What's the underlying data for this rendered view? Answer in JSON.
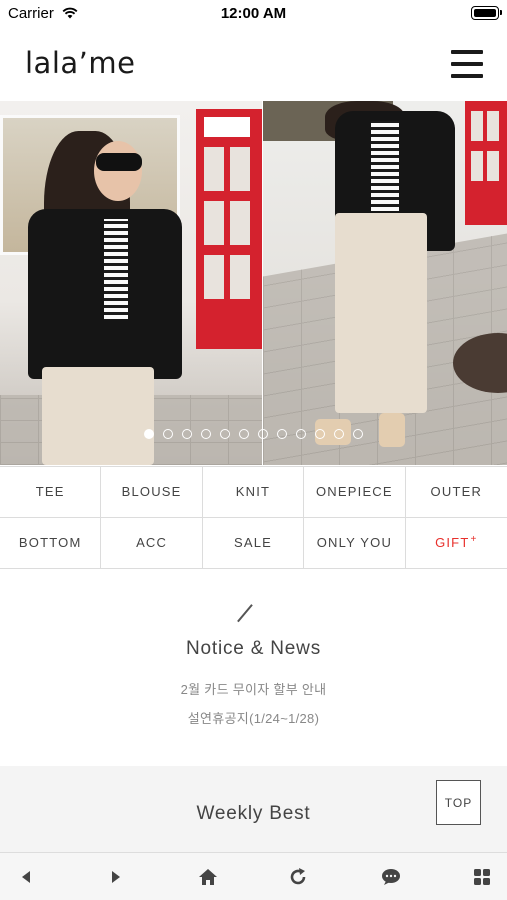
{
  "status": {
    "carrier": "Carrier",
    "time": "12:00 AM"
  },
  "header": {
    "logo": "lala’me"
  },
  "banner": {
    "slide_count": 12,
    "active_slide": 0
  },
  "categories": [
    {
      "label": "TEE"
    },
    {
      "label": "BLOUSE"
    },
    {
      "label": "KNIT"
    },
    {
      "label": "ONEPIECE"
    },
    {
      "label": "OUTER"
    },
    {
      "label": "BOTTOM"
    },
    {
      "label": "ACC"
    },
    {
      "label": "SALE"
    },
    {
      "label": "ONLY YOU"
    },
    {
      "label": "GIFT",
      "badge": "+"
    }
  ],
  "notice": {
    "title": "Notice & News",
    "items": [
      "2월 카드 무이자 할부 안내",
      "설연휴공지(1/24~1/28)"
    ]
  },
  "weekly": {
    "title": "Weekly Best",
    "top_button": "TOP"
  },
  "bottom_nav": [
    "back-icon",
    "forward-icon",
    "home-icon",
    "refresh-icon",
    "chat-icon",
    "grid-icon"
  ],
  "colors": {
    "accent_red": "#e8302c",
    "text": "#444444",
    "banner_dot": "#ffffff"
  }
}
